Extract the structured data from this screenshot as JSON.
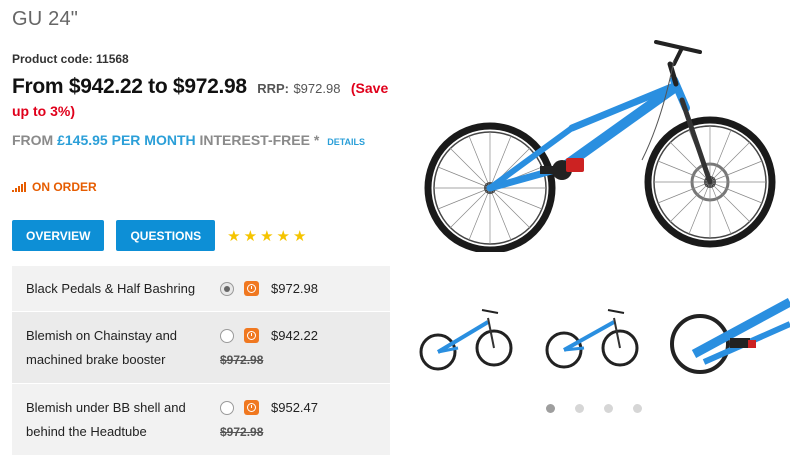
{
  "product": {
    "title": "GU 24\"",
    "code_label": "Product code:",
    "code_value": "11568"
  },
  "price": {
    "range": "From $942.22 to $972.98",
    "rrp_label": "RRP:",
    "rrp_value": "$972.98",
    "save": "(Save up to 3%)"
  },
  "finance": {
    "prefix": "FROM",
    "amount": "£145.95 PER MONTH",
    "suffix": "INTEREST-FREE",
    "asterisk": "*",
    "details": "DETAILS"
  },
  "stock": {
    "status": "ON ORDER",
    "icon": "signal-bars-icon",
    "color": "#e65c00"
  },
  "tabs": [
    {
      "label": "OVERVIEW"
    },
    {
      "label": "QUESTIONS"
    }
  ],
  "rating": {
    "stars": 5,
    "max": 5,
    "star_char": "★"
  },
  "options": [
    {
      "label": "Black Pedals & Half Bashring",
      "price": "$972.98",
      "was": "",
      "selected": true
    },
    {
      "label": "Blemish on Chainstay and machined brake booster",
      "price": "$942.22",
      "was": "$972.98",
      "selected": false
    },
    {
      "label": "Blemish under BB shell and behind the Headtube",
      "price": "$952.47",
      "was": "$972.98",
      "selected": false
    }
  ],
  "gallery": {
    "slides": 4,
    "active_slide": 1
  },
  "colors": {
    "accent_blue": "#0d8fd6",
    "finance_blue": "#2b9fd8",
    "save_red": "#e0001b",
    "stock_orange": "#e65c00",
    "star_yellow": "#f5c400",
    "bike_blue": "#2a8fe0"
  }
}
